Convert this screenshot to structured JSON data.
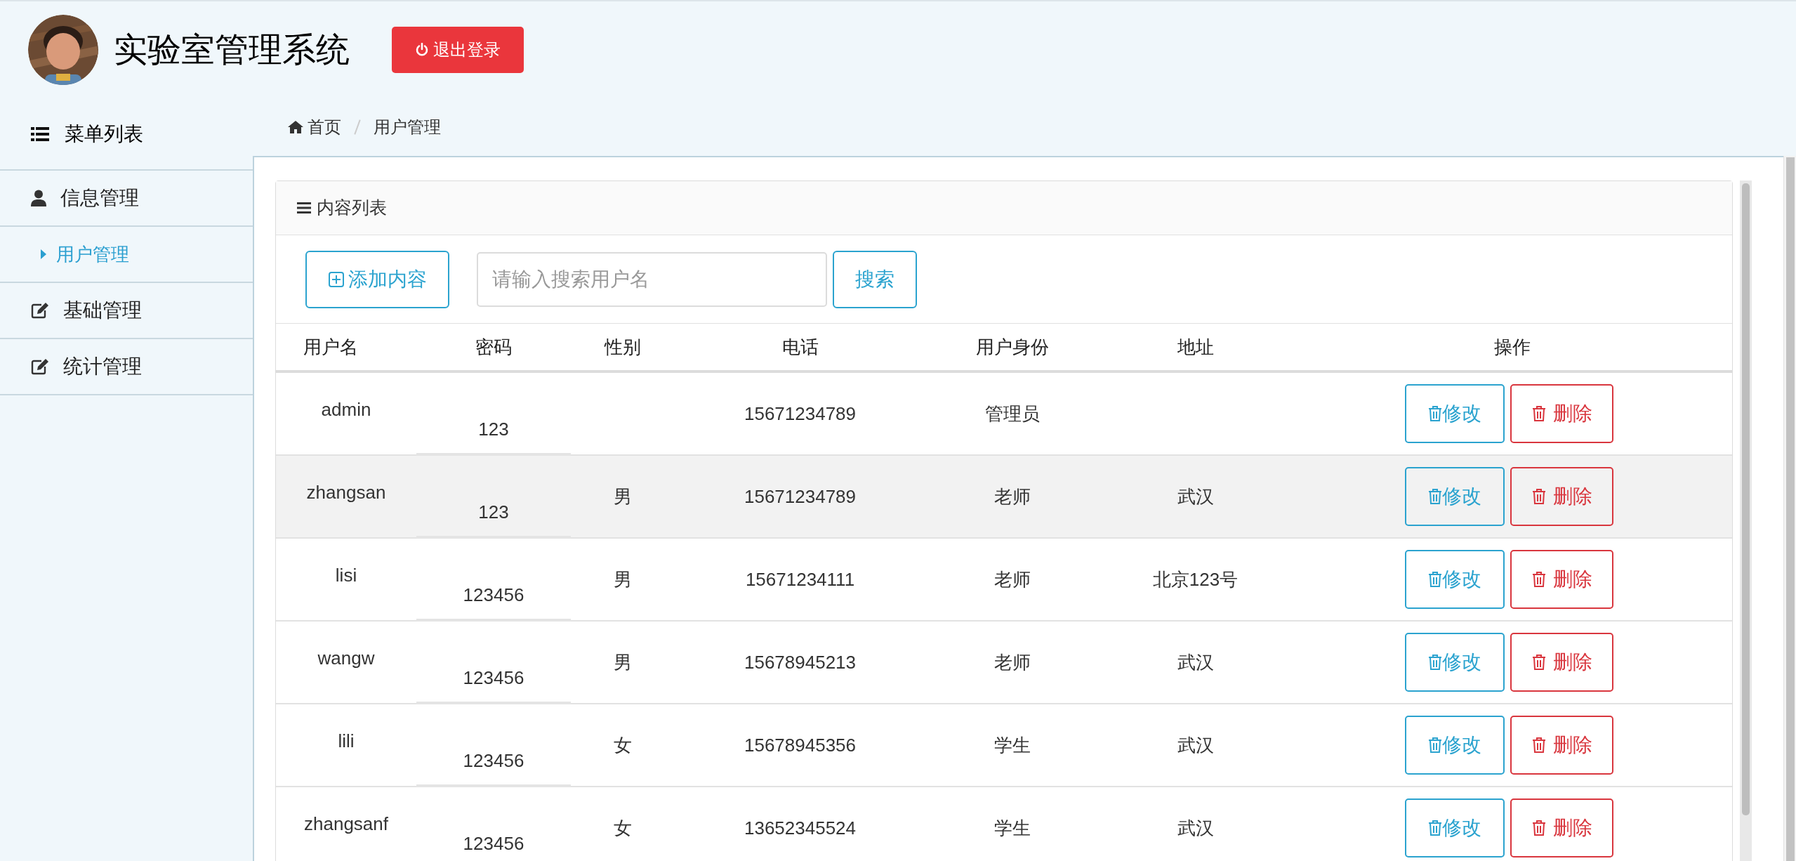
{
  "header": {
    "title": "实验室管理系统",
    "logout_button": "退出登录"
  },
  "sidebar": {
    "title": "菜单列表",
    "items": [
      {
        "label": "信息管理",
        "kind": "user",
        "children": [
          {
            "label": "用户管理",
            "selected": true
          }
        ]
      },
      {
        "label": "基础管理",
        "kind": "form"
      },
      {
        "label": "统计管理",
        "kind": "form"
      }
    ]
  },
  "breadcrumb": [
    {
      "label": "首页",
      "kind": "home"
    },
    {
      "label": "用户管理",
      "kind": "page"
    }
  ],
  "card": {
    "title": "内容列表",
    "add_button": "添加内容",
    "search": {
      "placeholder": "请输入搜索用户名"
    },
    "search_button": "搜索"
  },
  "table": {
    "columns": [
      "用户名",
      "密码",
      "性别",
      "电话",
      "用户身份",
      "地址",
      "操作"
    ],
    "rows": [
      {
        "username": "admin",
        "password": "123",
        "phone": "15671234789",
        "role": "管理员",
        "selected": false,
        "edit": "修改",
        "delete": "删除"
      },
      {
        "username": "zhangsan",
        "password": "123",
        "gender": "男",
        "phone": "15671234789",
        "role": "老师",
        "address": "武汉",
        "selected": true,
        "edit": "修改",
        "delete": "删除"
      },
      {
        "username": "lisi",
        "password": "123456",
        "gender": "男",
        "phone": "15671234111",
        "role": "老师",
        "address": "北京123号",
        "selected": false,
        "edit": "修改",
        "delete": "删除"
      },
      {
        "username": "wangw",
        "password": "123456",
        "gender": "男",
        "phone": "15678945213",
        "role": "老师",
        "address": "武汉",
        "selected": false,
        "edit": "修改",
        "delete": "删除"
      },
      {
        "username": "lili",
        "password": "123456",
        "gender": "女",
        "phone": "15678945356",
        "role": "学生",
        "address": "武汉",
        "selected": false,
        "edit": "修改",
        "delete": "删除"
      },
      {
        "username": "zhangsanf",
        "password": "123456",
        "gender": "女",
        "phone": "13652345524",
        "role": "学生",
        "address": "武汉",
        "selected": false,
        "edit": "修改",
        "delete": "删除"
      }
    ]
  }
}
